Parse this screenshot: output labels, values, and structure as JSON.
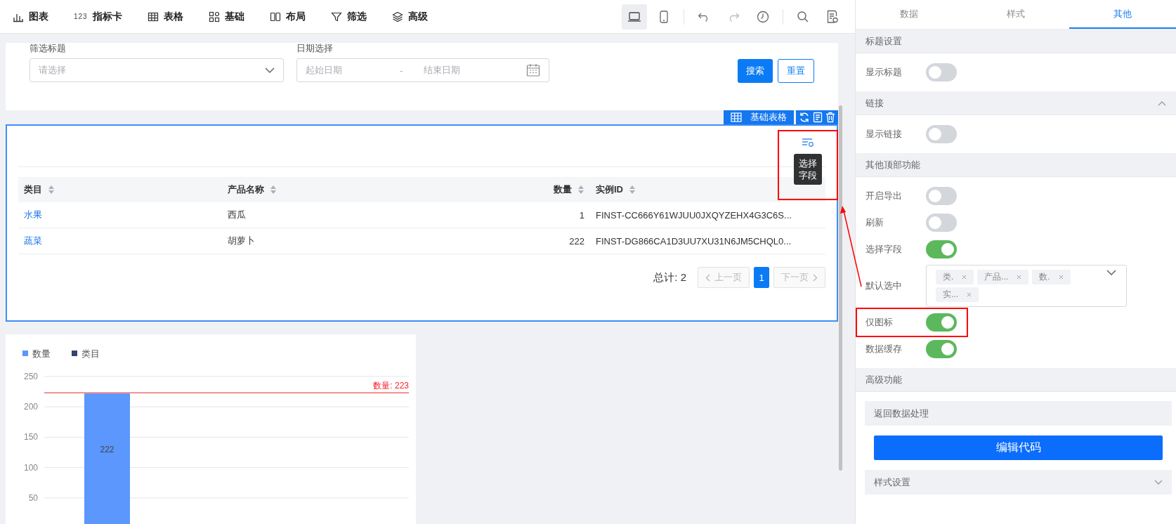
{
  "toolbar": {
    "items": [
      {
        "kind": "chart",
        "label": "图表"
      },
      {
        "kind": "number",
        "badge": "123",
        "label": "指标卡"
      },
      {
        "kind": "table",
        "label": "表格"
      },
      {
        "kind": "grid",
        "label": "基础"
      },
      {
        "kind": "columns",
        "label": "布局"
      },
      {
        "kind": "filter",
        "label": "筛选"
      },
      {
        "kind": "layers",
        "label": "高级"
      }
    ],
    "tools": [
      {
        "kind": "laptop",
        "selected": true
      },
      {
        "kind": "phone",
        "selected": false
      },
      {
        "kind": "undo",
        "selected": false
      },
      {
        "kind": "redo",
        "selected": false
      },
      {
        "kind": "clock",
        "selected": false
      },
      {
        "kind": "search",
        "selected": false
      },
      {
        "kind": "doc",
        "selected": false
      }
    ]
  },
  "filter": {
    "select": {
      "label": "筛选标题",
      "placeholder": "请选择"
    },
    "date": {
      "label": "日期选择",
      "start_placeholder": "起始日期",
      "separator": "-",
      "end_placeholder": "结束日期"
    },
    "buttons": [
      {
        "kind": "primary",
        "label": "搜索"
      },
      {
        "kind": "outline",
        "label": "重置"
      }
    ]
  },
  "table_widget": {
    "tag": "基础表格",
    "tooltip": "选择字段",
    "highlighted": true,
    "columns": [
      {
        "label": "类目"
      },
      {
        "label": "产品名称"
      },
      {
        "label": "数量"
      },
      {
        "label": "实例ID"
      }
    ],
    "rows": [
      [
        "水果",
        "西瓜",
        "1",
        "FINST-CC666Y61WJUU0JXQYZEHX4G3C6S..."
      ],
      [
        "蔬菜",
        "胡萝卜",
        "222",
        "FINST-DG866CA1D3UU7XU31N6JM5CHQL0..."
      ]
    ],
    "pagination": {
      "total": "总计: 2",
      "prev": "上一页",
      "pages": [
        {
          "label": "1",
          "selected": true
        }
      ],
      "next": "下一页"
    }
  },
  "chart_data": {
    "type": "bar",
    "grid": true,
    "series": [
      {
        "name": "数量",
        "color": "#5b97fd",
        "values": [
          222
        ]
      },
      {
        "name": "类目",
        "color": "#34466e",
        "values": [
          null
        ]
      }
    ],
    "ylim": [
      0,
      250
    ],
    "yticks": [
      50,
      100,
      150,
      200,
      250
    ],
    "data_labels": true,
    "ref_lines": [
      {
        "axis": "y",
        "value": 223,
        "label": "数量: 223",
        "color": "#f56c6c"
      }
    ]
  },
  "panel": {
    "tabs": [
      {
        "label": "数据",
        "selected": false
      },
      {
        "label": "样式",
        "selected": false
      },
      {
        "label": "其他",
        "selected": true
      }
    ],
    "sections": [
      {
        "title": "标题设置",
        "rows": [
          {
            "kind": "toggle",
            "label": "显示标题",
            "on": false
          }
        ]
      },
      {
        "title": "链接",
        "expanded": true,
        "rows": [
          {
            "kind": "toggle",
            "label": "显示链接",
            "on": false
          }
        ]
      },
      {
        "title": "其他顶部功能",
        "rows": [
          {
            "kind": "toggle",
            "label": "开启导出",
            "on": false
          },
          {
            "kind": "toggle",
            "label": "刷新",
            "on": false
          },
          {
            "kind": "toggle",
            "label": "选择字段",
            "on": true
          },
          {
            "kind": "multiselect",
            "label": "默认选中",
            "tags": [
              "类.",
              "产品...",
              "数.",
              "实..."
            ]
          },
          {
            "kind": "toggle",
            "label": "仅图标",
            "on": true,
            "highlighted": true
          },
          {
            "kind": "toggle",
            "label": "数据缓存",
            "on": true
          }
        ]
      },
      {
        "title": "高级功能",
        "rows": [
          {
            "kind": "subheader",
            "label": "返回数据处理"
          },
          {
            "kind": "button",
            "label": "编辑代码"
          },
          {
            "kind": "collapse",
            "label": "样式设置",
            "expanded": false
          }
        ]
      }
    ]
  }
}
